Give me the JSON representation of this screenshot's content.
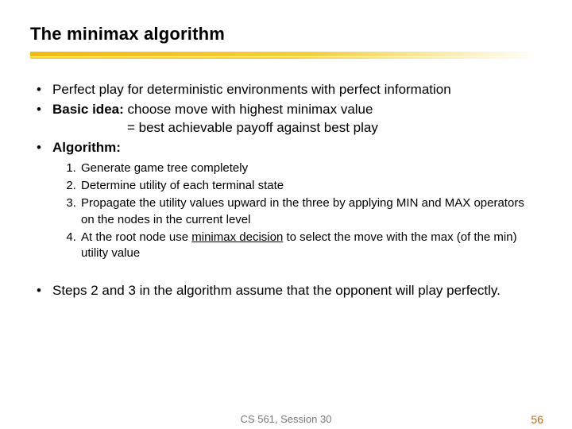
{
  "title": "The minimax algorithm",
  "bul1": "Perfect play for deterministic environments with perfect information",
  "bul2a": "Basic idea:",
  "bul2b": " choose move with highest minimax value",
  "bul2c": "= best achievable payoff against best play",
  "bul3": "Algorithm:",
  "step1": "Generate game tree completely",
  "step2": "Determine utility of each terminal state",
  "step3": "Propagate the utility values upward in the three by applying MIN and MAX operators on the nodes in the current level",
  "step4a": "At the root node use ",
  "step4u": "minimax decision",
  "step4b": " to select the move with the max (of the min) utility value",
  "bul4": "Steps 2 and 3 in the algorithm assume that the opponent will play perfectly.",
  "footer_center": "CS 561, Session 30",
  "page_num": "56"
}
